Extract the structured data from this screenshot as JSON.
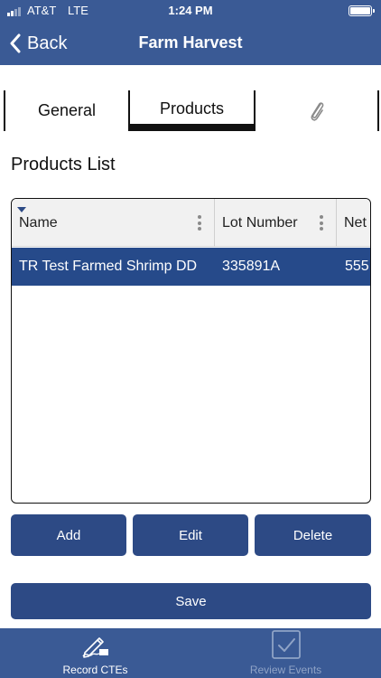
{
  "status": {
    "carrier": "AT&T",
    "network": "LTE",
    "time": "1:24 PM"
  },
  "nav": {
    "back_label": "Back",
    "title": "Farm Harvest"
  },
  "tabs": [
    {
      "label": "General",
      "selected": false
    },
    {
      "label": "Products",
      "selected": true
    },
    {
      "icon": "paperclip-icon",
      "selected": false
    }
  ],
  "products_list": {
    "title": "Products List",
    "columns": [
      "Name",
      "Lot Number",
      "Net"
    ],
    "rows": [
      {
        "name": "TR Test Farmed Shrimp DD",
        "lot_number": "335891A",
        "net": "555",
        "selected": true
      }
    ]
  },
  "actions": {
    "add_label": "Add",
    "edit_label": "Edit",
    "delete_label": "Delete",
    "save_label": "Save"
  },
  "bottom_tabs": [
    {
      "label": "Record CTEs",
      "icon": "pen-signature-icon",
      "active": true
    },
    {
      "label": "Review Events",
      "icon": "checklist-icon",
      "active": false
    }
  ],
  "colors": {
    "nav_background": "#3a5a95",
    "button_background": "#2d4a85",
    "selected_row": "#264a8a"
  }
}
